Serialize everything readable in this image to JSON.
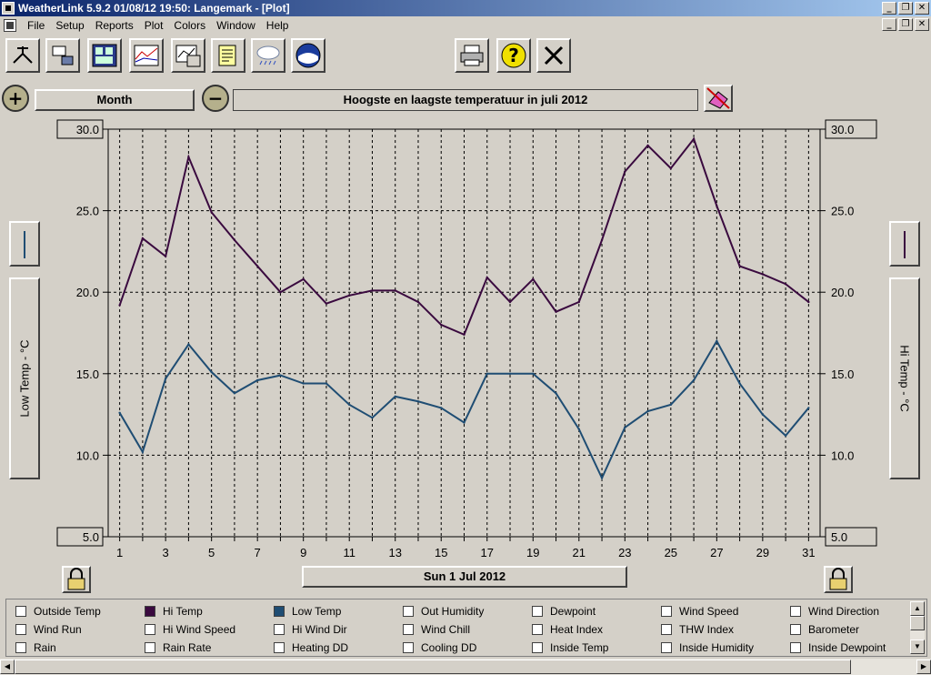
{
  "window": {
    "title": "WeatherLink 5.9.2  01/08/12  19:50: Langemark - [Plot]",
    "controls": [
      "_",
      "❐",
      "✕"
    ]
  },
  "menu": [
    "File",
    "Setup",
    "Reports",
    "Plot",
    "Colors",
    "Window",
    "Help"
  ],
  "toolbar": {
    "buttons": [
      "weather-station-icon",
      "computer-link-icon",
      "bulletin-icon",
      "strip-chart-icon",
      "plot-icon",
      "notes-icon",
      "rain-cloud-icon",
      "noaa-icon"
    ],
    "right_buttons": [
      "printer-icon",
      "help-icon",
      "close-icon"
    ]
  },
  "controls": {
    "zoom_in": "+",
    "zoom_out": "−",
    "period": "Month",
    "title": "Hoogste en laagste temperatuur in juli 2012"
  },
  "colors": {
    "hi_temp": "#3a0a3f",
    "low_temp": "#1f4d73",
    "grid": "#000000",
    "plot_bg": "#d4d0c8"
  },
  "axes": {
    "left_label": "Low Temp - °C",
    "right_label": "Hi Temp - °C",
    "date": "Sun 1 Jul 2012"
  },
  "chart_data": {
    "type": "line",
    "title": "Hoogste en laagste temperatuur in juli 2012",
    "x": [
      1,
      2,
      3,
      4,
      5,
      6,
      7,
      8,
      9,
      10,
      11,
      12,
      13,
      14,
      15,
      16,
      17,
      18,
      19,
      20,
      21,
      22,
      23,
      24,
      25,
      26,
      27,
      28,
      29,
      30,
      31
    ],
    "x_ticks": [
      1,
      3,
      5,
      7,
      9,
      11,
      13,
      15,
      17,
      19,
      21,
      23,
      25,
      27,
      29,
      31
    ],
    "xlim": [
      0.5,
      31.5
    ],
    "ylim": [
      5,
      30
    ],
    "y_ticks": [
      5,
      10,
      15,
      20,
      25,
      30
    ],
    "y_tick_labels": [
      "5.0",
      "10.0",
      "15.0",
      "20.0",
      "25.0",
      "30.0"
    ],
    "ylabel_left": "Low Temp - °C",
    "ylabel_right": "Hi Temp - °C",
    "grid": true,
    "series": [
      {
        "name": "Hi Temp",
        "values": [
          19.2,
          23.3,
          22.2,
          28.3,
          24.9,
          23.2,
          21.6,
          20.0,
          20.8,
          19.3,
          19.8,
          20.1,
          20.1,
          19.4,
          18.0,
          17.4,
          20.9,
          19.4,
          20.8,
          18.8,
          19.4,
          23.2,
          27.4,
          29.0,
          27.6,
          29.4,
          25.3,
          21.6,
          21.1,
          20.5,
          19.4
        ]
      },
      {
        "name": "Low Temp",
        "values": [
          12.6,
          10.2,
          14.7,
          16.8,
          15.1,
          13.8,
          14.6,
          14.9,
          14.4,
          14.4,
          13.1,
          12.3,
          13.6,
          13.3,
          12.9,
          12.0,
          15.0,
          15.0,
          15.0,
          13.8,
          11.6,
          8.6,
          11.7,
          12.7,
          13.1,
          14.6,
          17.0,
          14.4,
          12.5,
          11.2,
          12.9
        ]
      }
    ]
  },
  "legend": [
    {
      "label": "Outside Temp",
      "checked": false
    },
    {
      "label": "Hi Temp",
      "checked": true,
      "color": "#3a0a3f"
    },
    {
      "label": "Low Temp",
      "checked": true,
      "color": "#1f4d73"
    },
    {
      "label": "Out Humidity",
      "checked": false
    },
    {
      "label": "Dewpoint",
      "checked": false
    },
    {
      "label": "Wind Speed",
      "checked": false
    },
    {
      "label": "Wind Direction",
      "checked": false
    },
    {
      "label": "Wind Run",
      "checked": false
    },
    {
      "label": "Hi Wind Speed",
      "checked": false
    },
    {
      "label": "Hi Wind Dir",
      "checked": false
    },
    {
      "label": "Wind Chill",
      "checked": false
    },
    {
      "label": "Heat Index",
      "checked": false
    },
    {
      "label": "THW Index",
      "checked": false
    },
    {
      "label": "Barometer",
      "checked": false
    },
    {
      "label": "Rain",
      "checked": false
    },
    {
      "label": "Rain Rate",
      "checked": false
    },
    {
      "label": "Heating DD",
      "checked": false
    },
    {
      "label": "Cooling DD",
      "checked": false
    },
    {
      "label": "Inside Temp",
      "checked": false
    },
    {
      "label": "Inside Humidity",
      "checked": false
    },
    {
      "label": "Inside Dewpoint",
      "checked": false
    }
  ]
}
